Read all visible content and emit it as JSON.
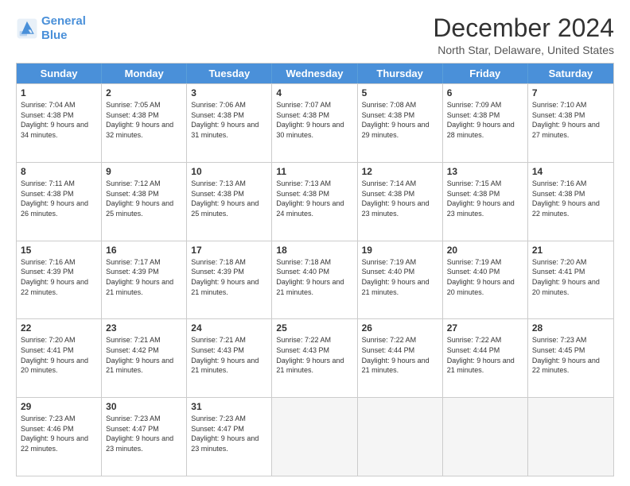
{
  "logo": {
    "line1": "General",
    "line2": "Blue"
  },
  "title": "December 2024",
  "subtitle": "North Star, Delaware, United States",
  "days": [
    "Sunday",
    "Monday",
    "Tuesday",
    "Wednesday",
    "Thursday",
    "Friday",
    "Saturday"
  ],
  "weeks": [
    [
      {
        "num": "1",
        "sunrise": "7:04 AM",
        "sunset": "4:38 PM",
        "daylight": "9 hours and 34 minutes."
      },
      {
        "num": "2",
        "sunrise": "7:05 AM",
        "sunset": "4:38 PM",
        "daylight": "9 hours and 32 minutes."
      },
      {
        "num": "3",
        "sunrise": "7:06 AM",
        "sunset": "4:38 PM",
        "daylight": "9 hours and 31 minutes."
      },
      {
        "num": "4",
        "sunrise": "7:07 AM",
        "sunset": "4:38 PM",
        "daylight": "9 hours and 30 minutes."
      },
      {
        "num": "5",
        "sunrise": "7:08 AM",
        "sunset": "4:38 PM",
        "daylight": "9 hours and 29 minutes."
      },
      {
        "num": "6",
        "sunrise": "7:09 AM",
        "sunset": "4:38 PM",
        "daylight": "9 hours and 28 minutes."
      },
      {
        "num": "7",
        "sunrise": "7:10 AM",
        "sunset": "4:38 PM",
        "daylight": "9 hours and 27 minutes."
      }
    ],
    [
      {
        "num": "8",
        "sunrise": "7:11 AM",
        "sunset": "4:38 PM",
        "daylight": "9 hours and 26 minutes."
      },
      {
        "num": "9",
        "sunrise": "7:12 AM",
        "sunset": "4:38 PM",
        "daylight": "9 hours and 25 minutes."
      },
      {
        "num": "10",
        "sunrise": "7:13 AM",
        "sunset": "4:38 PM",
        "daylight": "9 hours and 25 minutes."
      },
      {
        "num": "11",
        "sunrise": "7:13 AM",
        "sunset": "4:38 PM",
        "daylight": "9 hours and 24 minutes."
      },
      {
        "num": "12",
        "sunrise": "7:14 AM",
        "sunset": "4:38 PM",
        "daylight": "9 hours and 23 minutes."
      },
      {
        "num": "13",
        "sunrise": "7:15 AM",
        "sunset": "4:38 PM",
        "daylight": "9 hours and 23 minutes."
      },
      {
        "num": "14",
        "sunrise": "7:16 AM",
        "sunset": "4:38 PM",
        "daylight": "9 hours and 22 minutes."
      }
    ],
    [
      {
        "num": "15",
        "sunrise": "7:16 AM",
        "sunset": "4:39 PM",
        "daylight": "9 hours and 22 minutes."
      },
      {
        "num": "16",
        "sunrise": "7:17 AM",
        "sunset": "4:39 PM",
        "daylight": "9 hours and 21 minutes."
      },
      {
        "num": "17",
        "sunrise": "7:18 AM",
        "sunset": "4:39 PM",
        "daylight": "9 hours and 21 minutes."
      },
      {
        "num": "18",
        "sunrise": "7:18 AM",
        "sunset": "4:40 PM",
        "daylight": "9 hours and 21 minutes."
      },
      {
        "num": "19",
        "sunrise": "7:19 AM",
        "sunset": "4:40 PM",
        "daylight": "9 hours and 21 minutes."
      },
      {
        "num": "20",
        "sunrise": "7:19 AM",
        "sunset": "4:40 PM",
        "daylight": "9 hours and 20 minutes."
      },
      {
        "num": "21",
        "sunrise": "7:20 AM",
        "sunset": "4:41 PM",
        "daylight": "9 hours and 20 minutes."
      }
    ],
    [
      {
        "num": "22",
        "sunrise": "7:20 AM",
        "sunset": "4:41 PM",
        "daylight": "9 hours and 20 minutes."
      },
      {
        "num": "23",
        "sunrise": "7:21 AM",
        "sunset": "4:42 PM",
        "daylight": "9 hours and 21 minutes."
      },
      {
        "num": "24",
        "sunrise": "7:21 AM",
        "sunset": "4:43 PM",
        "daylight": "9 hours and 21 minutes."
      },
      {
        "num": "25",
        "sunrise": "7:22 AM",
        "sunset": "4:43 PM",
        "daylight": "9 hours and 21 minutes."
      },
      {
        "num": "26",
        "sunrise": "7:22 AM",
        "sunset": "4:44 PM",
        "daylight": "9 hours and 21 minutes."
      },
      {
        "num": "27",
        "sunrise": "7:22 AM",
        "sunset": "4:44 PM",
        "daylight": "9 hours and 21 minutes."
      },
      {
        "num": "28",
        "sunrise": "7:23 AM",
        "sunset": "4:45 PM",
        "daylight": "9 hours and 22 minutes."
      }
    ],
    [
      {
        "num": "29",
        "sunrise": "7:23 AM",
        "sunset": "4:46 PM",
        "daylight": "9 hours and 22 minutes."
      },
      {
        "num": "30",
        "sunrise": "7:23 AM",
        "sunset": "4:47 PM",
        "daylight": "9 hours and 23 minutes."
      },
      {
        "num": "31",
        "sunrise": "7:23 AM",
        "sunset": "4:47 PM",
        "daylight": "9 hours and 23 minutes."
      },
      null,
      null,
      null,
      null
    ]
  ]
}
